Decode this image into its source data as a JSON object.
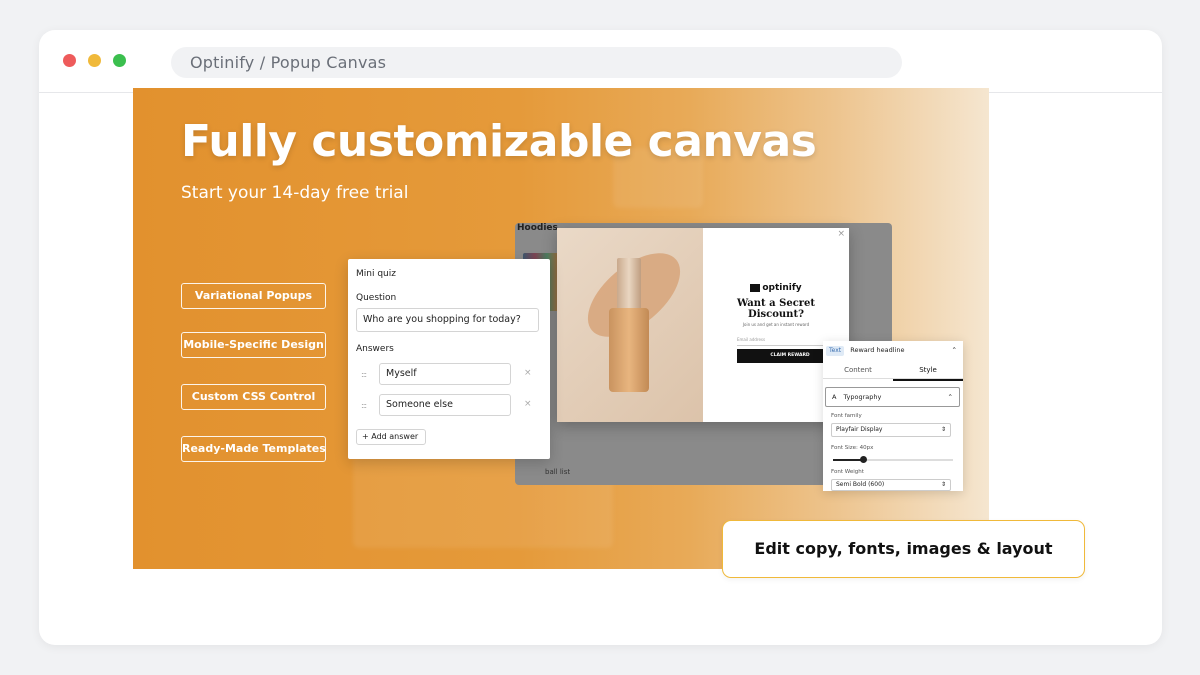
{
  "browser": {
    "url": "Optinify / Popup Canvas"
  },
  "banner": {
    "headline": "Fully customizable canvas",
    "subhead": "Start your 14-day free trial",
    "features": [
      "Variational Popups",
      "Mobile-Specific Design",
      "Custom CSS Control",
      "Ready-Made Templates"
    ]
  },
  "store": {
    "title": "Hoodies",
    "footer": "ball list"
  },
  "popup": {
    "brand": "optinify",
    "title_line1": "Want a Secret",
    "title_line2": "Discount?",
    "small_text": "Join us and get an instant reward",
    "email_placeholder": "Email address",
    "button": "CLAIM REWARD",
    "close": "×"
  },
  "quiz": {
    "title": "Mini quiz",
    "question_label": "Question",
    "question_value": "Who are you shopping for today?",
    "answers_label": "Answers",
    "answers": [
      "Myself",
      "Someone else"
    ],
    "remove": "×",
    "handle": ":::",
    "add_answer": "+ Add answer"
  },
  "editor": {
    "tag": "Text",
    "element": "Reward headline",
    "tabs": [
      "Content",
      "Style"
    ],
    "active_tab": "Style",
    "section": "Typography",
    "font_family_label": "Font family",
    "font_family_value": "Playfair Display",
    "font_size_label": "Font Size: 40px",
    "font_size_fraction": 0.25,
    "font_weight_label": "Font Weight",
    "font_weight_value": "Semi Bold (600)"
  },
  "callout": {
    "text": "Edit copy, fonts, images & layout"
  },
  "colors": {
    "accent_orange": "#e2912e",
    "callout_border": "#f0b93a"
  }
}
